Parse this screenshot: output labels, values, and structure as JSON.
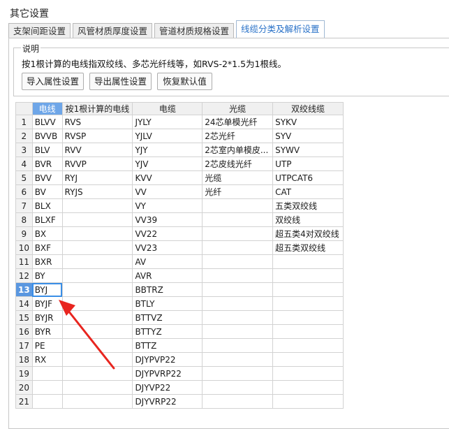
{
  "window": {
    "title": "其它设置"
  },
  "tabs": [
    {
      "label": "支架间距设置",
      "active": false
    },
    {
      "label": "风管材质厚度设置",
      "active": false
    },
    {
      "label": "管道材质规格设置",
      "active": false
    },
    {
      "label": "线缆分类及解析设置",
      "active": true
    }
  ],
  "description": {
    "group_title": "说明",
    "text": "按1根计算的电线指双绞线、多芯光纤线等，如RVS-2*1.5为1根线。"
  },
  "buttons": {
    "import_label": "导入属性设置",
    "export_label": "导出属性设置",
    "reset_label": "恢复默认值"
  },
  "table": {
    "columns": [
      "电线",
      "按1根计算的电线",
      "电缆",
      "光缆",
      "双绞线缆"
    ],
    "selected_column": 0,
    "selected_row": 13,
    "rows": [
      [
        "1",
        "BLVV",
        "RVS",
        "JYLY",
        "24芯单模光纤",
        "SYKV"
      ],
      [
        "2",
        "BVVB",
        "RVSP",
        "YJLV",
        "2芯光纤",
        "SYV"
      ],
      [
        "3",
        "BLV",
        "RVV",
        "YJY",
        "2芯室内单模皮...",
        "SYWV"
      ],
      [
        "4",
        "BVR",
        "RVVP",
        "YJV",
        "2芯皮线光纤",
        "UTP"
      ],
      [
        "5",
        "BVV",
        "RYJ",
        "KVV",
        "光缆",
        "UTPCAT6"
      ],
      [
        "6",
        "BV",
        "RYJS",
        "VV",
        "光纤",
        "CAT"
      ],
      [
        "7",
        "BLX",
        "",
        "VY",
        "",
        "五类双绞线"
      ],
      [
        "8",
        "BLXF",
        "",
        "VV39",
        "",
        "双绞线"
      ],
      [
        "9",
        "BX",
        "",
        "VV22",
        "",
        "超五类4对双绞线"
      ],
      [
        "10",
        "BXF",
        "",
        "VV23",
        "",
        "超五类双绞线"
      ],
      [
        "11",
        "BXR",
        "",
        "AV",
        "",
        ""
      ],
      [
        "12",
        "BY",
        "",
        "AVR",
        "",
        ""
      ],
      [
        "13",
        "BYJ",
        "",
        "BBTRZ",
        "",
        ""
      ],
      [
        "14",
        "BYJF",
        "",
        "BTLY",
        "",
        ""
      ],
      [
        "15",
        "BYJR",
        "",
        "BTTVZ",
        "",
        ""
      ],
      [
        "16",
        "BYR",
        "",
        "BTTYZ",
        "",
        ""
      ],
      [
        "17",
        "PE",
        "",
        "BTTZ",
        "",
        ""
      ],
      [
        "18",
        "RX",
        "",
        "DJYPVP22",
        "",
        ""
      ],
      [
        "19",
        "",
        "",
        "DJYPVRP22",
        "",
        ""
      ],
      [
        "20",
        "",
        "",
        "DJYVP22",
        "",
        ""
      ],
      [
        "21",
        "",
        "",
        "DJYVRP22",
        "",
        ""
      ]
    ]
  },
  "annotation": {
    "arrow_color": "#e8251f"
  }
}
